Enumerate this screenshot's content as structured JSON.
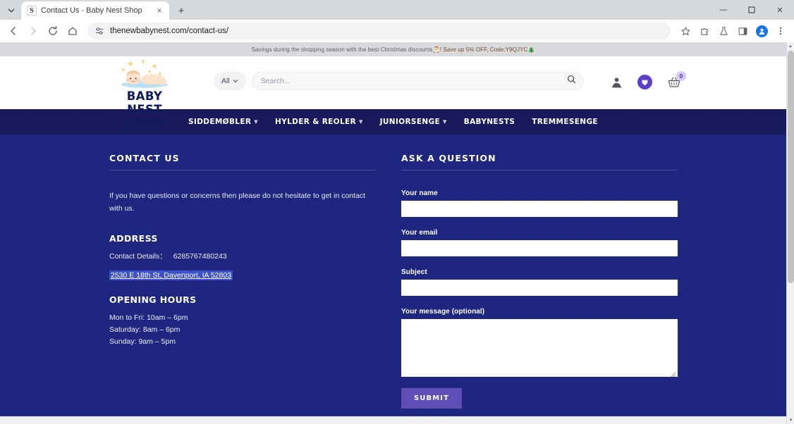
{
  "browser": {
    "tab": {
      "title": "Contact Us - Baby Nest Shop",
      "favicon_letter": "S",
      "close_label": "×"
    },
    "new_tab_label": "+",
    "tab_list_icon": "chevron-down-icon",
    "window": {
      "minimize": "—",
      "maximize": "☐",
      "close": "✕"
    },
    "nav": {
      "back": "←",
      "forward": "→",
      "reload": "↻",
      "home": "⌂"
    },
    "omnibox": {
      "url": "thenewbabynest.com/contact-us/",
      "site_info_icon": "tune-icon"
    },
    "toolbar_right": [
      "bookmark-star-icon",
      "extensions-puzzle-icon",
      "lab-flask-icon",
      "side-panel-icon",
      "profile-avatar-icon",
      "three-dot-menu-icon"
    ]
  },
  "promo": {
    "text_before": "Savings during the shopping season with the best Christmas discounts ",
    "emoji_1": "🎅",
    "text_after": "! Save up 5% OFF, Code:Y9QJYC ",
    "emoji_2": "🎄"
  },
  "header": {
    "logo_text": "BABY NEST SHOP",
    "category_select": {
      "value": "All",
      "caret": "⌄"
    },
    "search": {
      "placeholder": "Search...",
      "value": "",
      "button_icon": "search-icon"
    },
    "icons": {
      "account": "user-icon",
      "wishlist": "heart-icon",
      "cart": "shopping-basket-icon",
      "cart_count": "0"
    }
  },
  "nav_menu": [
    {
      "label": "SIDDEMØBLER",
      "has_caret": true
    },
    {
      "label": "HYLDER & REOLER",
      "has_caret": true
    },
    {
      "label": "JUNIORSENGE",
      "has_caret": true
    },
    {
      "label": "BABYNESTS",
      "has_caret": false
    },
    {
      "label": "TREMMESENGE",
      "has_caret": false
    }
  ],
  "contact": {
    "title": "CONTACT US",
    "intro": "If you have questions or concerns then please do not hesitate to get in contact with us.",
    "address_title": "ADDRESS",
    "contact_details_label": "Contact Details：",
    "contact_details_value": "6285767480243",
    "address_link": "2530 E 18th St, Davenport, IA 52803",
    "hours_title": "OPENING HOURS",
    "hours": [
      "Mon to Fri: 10am – 6pm",
      "Saturday: 8am – 6pm",
      "Sunday: 9am – 5pm"
    ]
  },
  "form": {
    "title": "ASK A QUESTION",
    "fields": [
      {
        "label": "Your name",
        "value": "",
        "type": "text"
      },
      {
        "label": "Your email",
        "value": "",
        "type": "text"
      },
      {
        "label": "Subject",
        "value": "",
        "type": "text"
      }
    ],
    "message": {
      "label": "Your message (optional)",
      "value": ""
    },
    "submit_label": "SUBMIT"
  },
  "colors": {
    "page_bg": "#1e2680",
    "navbar_bg": "#191a5c",
    "accent_purple": "#5b3fc4",
    "submit_purple": "#5f4eb5",
    "promo_bg": "#d9dadd",
    "logo_navy": "#0f1a5e"
  }
}
